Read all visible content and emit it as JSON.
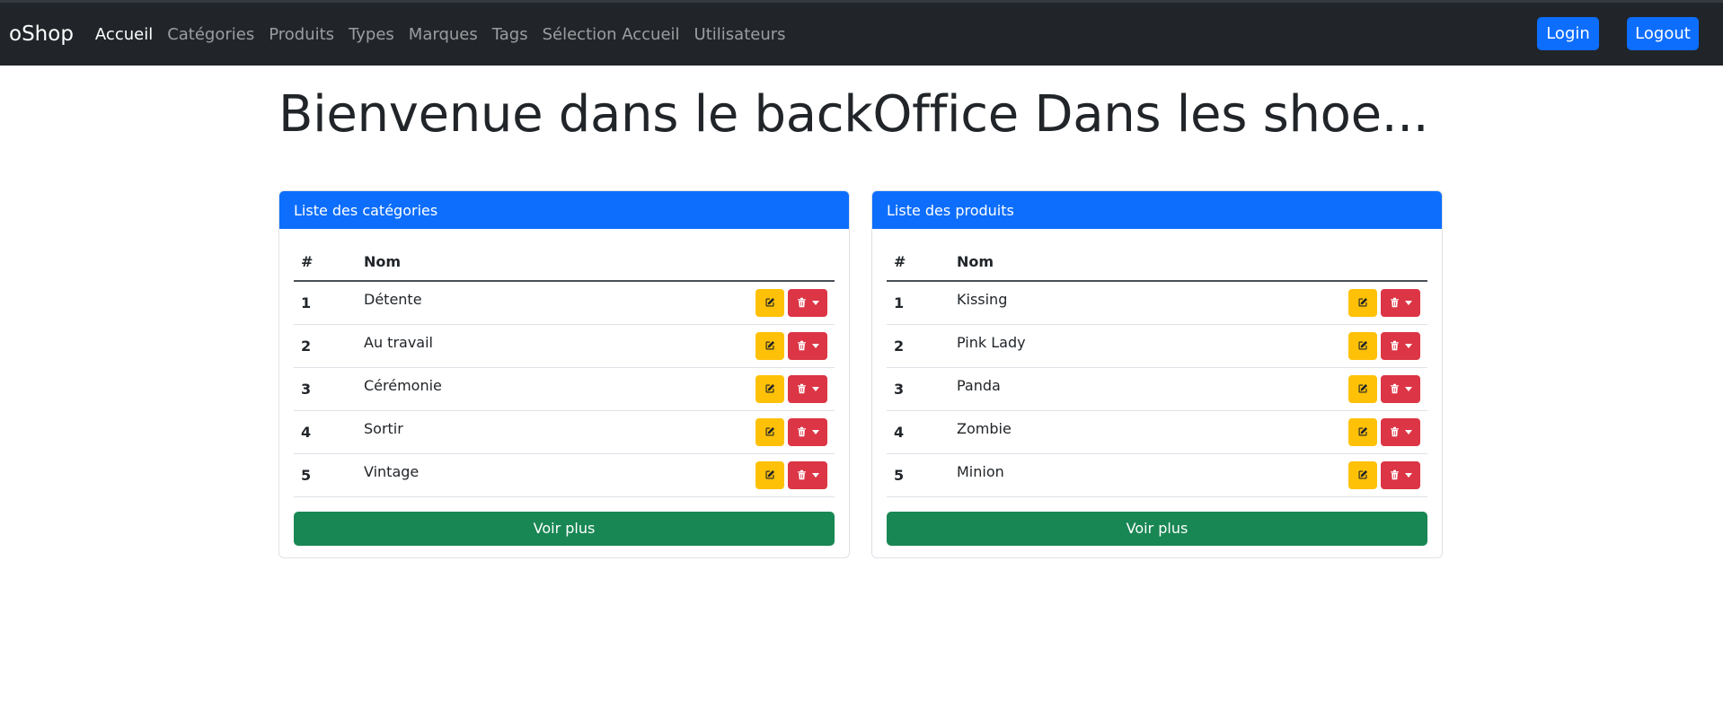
{
  "navbar": {
    "brand": "oShop",
    "links": [
      {
        "label": "Accueil",
        "active": true
      },
      {
        "label": "Catégories"
      },
      {
        "label": "Produits"
      },
      {
        "label": "Types"
      },
      {
        "label": "Marques"
      },
      {
        "label": "Tags"
      },
      {
        "label": "Sélection Accueil"
      },
      {
        "label": "Utilisateurs"
      }
    ],
    "login_label": "Login",
    "logout_label": "Logout"
  },
  "page_title": "Bienvenue dans le backOffice Dans les shoe...",
  "categories_card": {
    "title": "Liste des catégories",
    "columns": [
      "#",
      "Nom"
    ],
    "rows": [
      {
        "id": "1",
        "name": "Détente"
      },
      {
        "id": "2",
        "name": "Au travail"
      },
      {
        "id": "3",
        "name": "Cérémonie"
      },
      {
        "id": "4",
        "name": "Sortir"
      },
      {
        "id": "5",
        "name": "Vintage"
      }
    ],
    "more_label": "Voir plus"
  },
  "products_card": {
    "title": "Liste des produits",
    "columns": [
      "#",
      "Nom"
    ],
    "rows": [
      {
        "id": "1",
        "name": "Kissing"
      },
      {
        "id": "2",
        "name": "Pink Lady"
      },
      {
        "id": "3",
        "name": "Panda"
      },
      {
        "id": "4",
        "name": "Zombie"
      },
      {
        "id": "5",
        "name": "Minion"
      }
    ],
    "more_label": "Voir plus"
  },
  "icons": {
    "edit": "pencil-square-icon",
    "delete": "trash-icon",
    "dropdown": "caret-down-icon"
  },
  "colors": {
    "navbar_bg": "#212529",
    "primary": "#0d6efd",
    "warning": "#ffc107",
    "danger": "#dc3545",
    "success": "#198754"
  }
}
